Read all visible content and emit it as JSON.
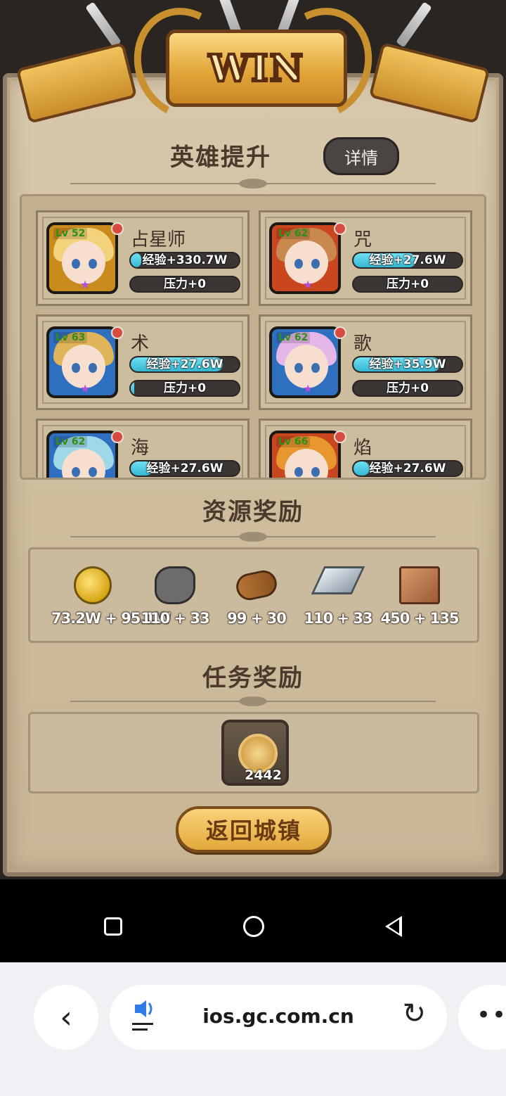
{
  "banner": {
    "title": "WIN"
  },
  "hero_section": {
    "title": "英雄提升",
    "detail_button": "详情"
  },
  "heroes": [
    {
      "name": "占星师",
      "level": "Lv 52",
      "exp": "经验+330.7W",
      "pressure": "压力+0",
      "frame_color": "#c98a1e",
      "hair_color": "#f2d27a"
    },
    {
      "name": "咒",
      "level": "Lv 62",
      "exp": "经验+27.6W",
      "pressure": "压力+0",
      "frame_color": "#c9461e",
      "hair_color": "#c9894e"
    },
    {
      "name": "术",
      "level": "Lv 63",
      "exp": "经验+27.6W",
      "pressure": "压力+0",
      "frame_color": "#2f6fc0",
      "hair_color": "#e0b55a"
    },
    {
      "name": "歌",
      "level": "Lv 62",
      "exp": "经验+35.9W",
      "pressure": "压力+0",
      "frame_color": "#2f6fc0",
      "hair_color": "#e5b7e8"
    },
    {
      "name": "海",
      "level": "Lv 62",
      "exp": "经验+27.6W",
      "pressure": "",
      "frame_color": "#2f6fc0",
      "hair_color": "#9fd8e8"
    },
    {
      "name": "焰",
      "level": "Lv 66",
      "exp": "经验+27.6W",
      "pressure": "",
      "frame_color": "#c9461e",
      "hair_color": "#e8972e"
    }
  ],
  "resource_section": {
    "title": "资源奖励",
    "items": [
      {
        "icon": "gold-coin-icon",
        "amount": "73.2W + 95.1W"
      },
      {
        "icon": "ore-icon",
        "amount": "110 + 33"
      },
      {
        "icon": "wood-icon",
        "amount": "99 + 30"
      },
      {
        "icon": "iron-ingot-icon",
        "amount": "110 + 33"
      },
      {
        "icon": "leather-icon",
        "amount": "450 + 135"
      }
    ]
  },
  "task_section": {
    "title": "任务奖励",
    "reward_count": "2442"
  },
  "return_button": "返回城镇",
  "browser": {
    "url": "ios.gc.com.cn",
    "back_glyph": "‹",
    "reload_glyph": "↻",
    "more_glyph": "•••"
  }
}
